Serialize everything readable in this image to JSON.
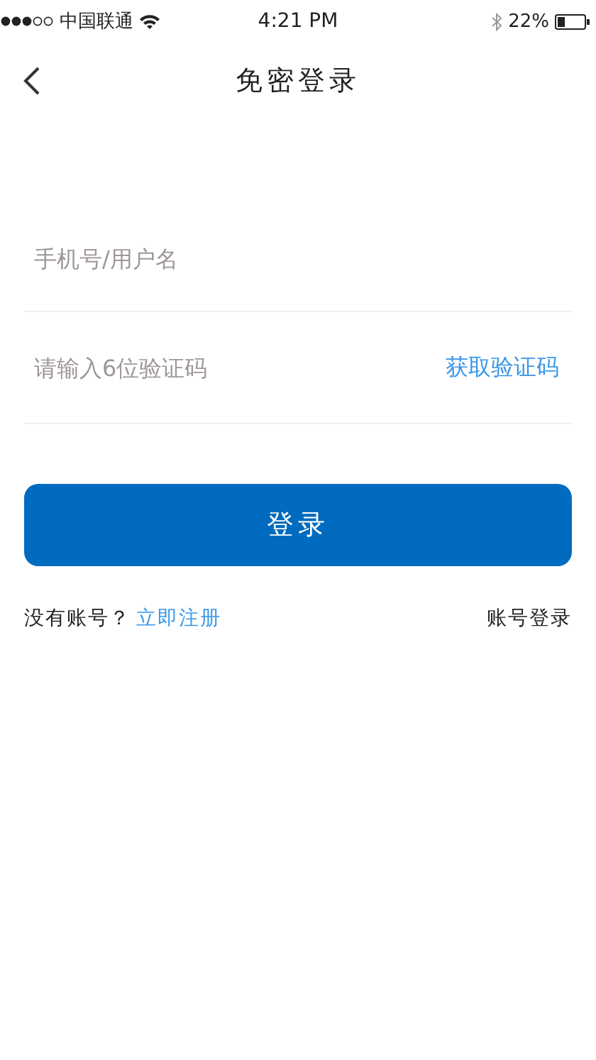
{
  "status_bar": {
    "carrier": "中国联通",
    "time": "4:21 PM",
    "battery": "22%"
  },
  "nav": {
    "title": "免密登录"
  },
  "form": {
    "account": {
      "placeholder": "手机号/用户名"
    },
    "code": {
      "placeholder": "请输入6位验证码"
    },
    "get_code": "获取验证码",
    "submit": "登录"
  },
  "footer": {
    "prompt": "没有账号？",
    "register": "立即注册",
    "account_login": "账号登录"
  }
}
